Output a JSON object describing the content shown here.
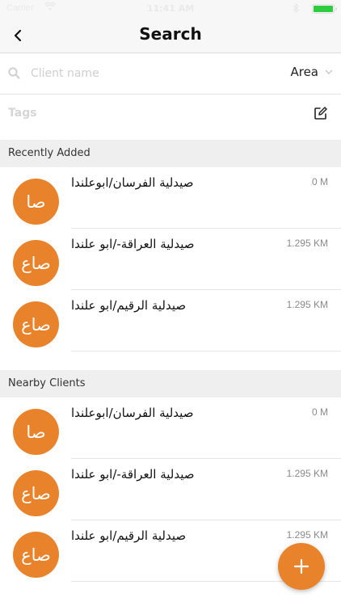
{
  "status_bar": {
    "carrier": "Carrier",
    "time": "11:41 AM",
    "battery_level": 1.0
  },
  "nav": {
    "title": "Search"
  },
  "search": {
    "placeholder": "Client name",
    "area_label": "Area"
  },
  "tags": {
    "label": "Tags"
  },
  "sections": {
    "recent": {
      "title": "Recently Added",
      "items": [
        {
          "avatar": "صا",
          "name": "صيدلية الفرسان/ابوعلندا",
          "distance": "0 M"
        },
        {
          "avatar": "صاع",
          "name": "صيدلية العراقة-/ابو علندا",
          "distance": "1.295 KM"
        },
        {
          "avatar": "صاع",
          "name": "صيدلية الرقيم/ابو علندا",
          "distance": "1.295 KM"
        }
      ]
    },
    "nearby": {
      "title": "Nearby Clients",
      "items": [
        {
          "avatar": "صا",
          "name": "صيدلية الفرسان/ابوعلندا",
          "distance": "0 M"
        },
        {
          "avatar": "صاع",
          "name": "صيدلية العراقة-/ابو علندا",
          "distance": "1.295 KM"
        },
        {
          "avatar": "صاع",
          "name": "صيدلية الرقيم/ابو علندا",
          "distance": "1.295 KM"
        }
      ]
    }
  },
  "fab": {
    "icon": "plus-icon"
  },
  "colors": {
    "accent": "#e8822b",
    "section_bg": "#efefef",
    "nav_bg": "#f7f7f7"
  }
}
